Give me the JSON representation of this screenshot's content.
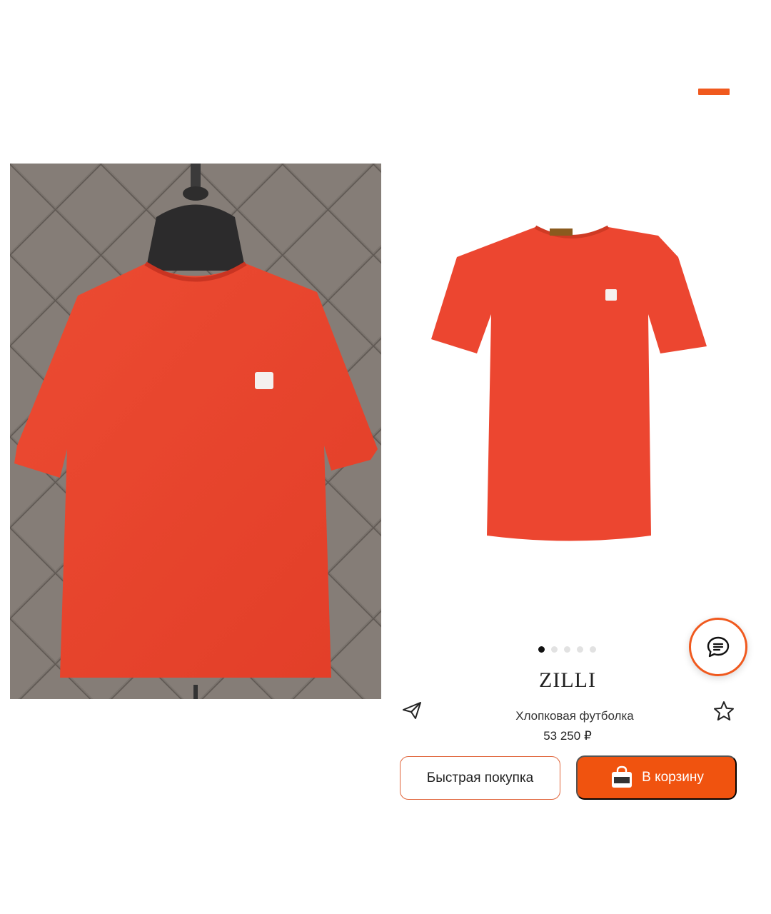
{
  "colors": {
    "accent": "#f0591e",
    "button_primary": "#f0530f",
    "shirt": "#e8452b"
  },
  "gallery": {
    "slides": 5,
    "active_index": 0
  },
  "product": {
    "brand": "ZILLI",
    "name": "Хлопковая футболка",
    "price": "53 250 ₽"
  },
  "actions": {
    "quick_buy_label": "Быстрая покупка",
    "cart_label": "В корзину"
  },
  "icons": {
    "share": "paper-plane-icon",
    "favorite": "star-icon",
    "chat": "chat-bubble-icon",
    "cart": "shopping-bag-icon"
  }
}
